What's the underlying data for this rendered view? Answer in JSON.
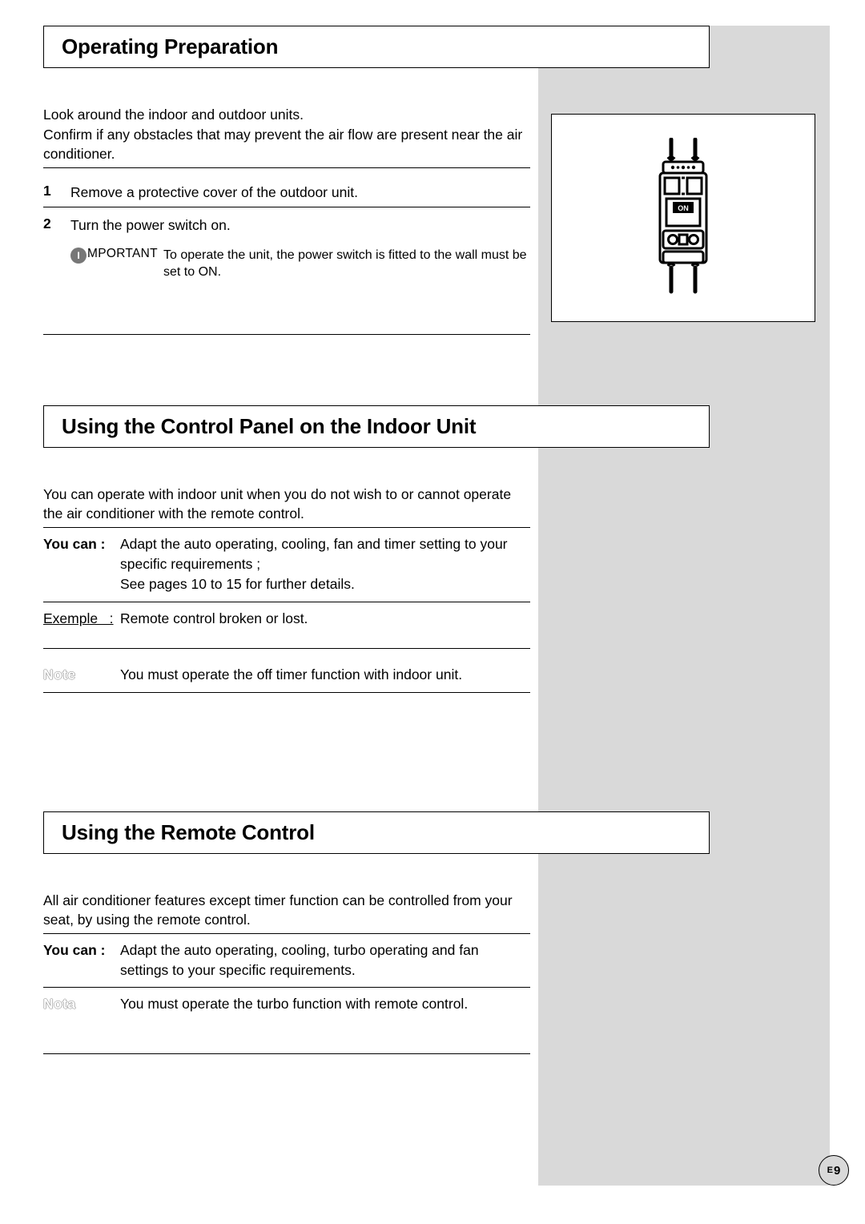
{
  "page_number_prefix": "E",
  "page_number": "9",
  "switch_label": "ON",
  "sections": [
    {
      "heading": "Operating Preparation",
      "intro": "Look around the indoor and outdoor units.\nConfirm if any obstacles that may prevent the air flow are present near the air conditioner.",
      "steps": [
        {
          "num": "1",
          "text": "Remove a protective cover of the outdoor unit."
        },
        {
          "num": "2",
          "text": "Turn the power switch on.",
          "important": {
            "icon_letter": "I",
            "label": "MPORTANT",
            "text": "To operate the unit, the power switch is fitted to the wall must be set to ON."
          }
        }
      ]
    },
    {
      "heading": "Using the Control Panel on the Indoor Unit",
      "intro": "You can operate with indoor unit when you do not wish to or cannot operate the air conditioner with the remote control.",
      "rows": [
        {
          "label": "You can :",
          "label_style": "bold",
          "value": "Adapt the auto operating, cooling, fan and timer setting to your specific requirements ;\nSee pages 10 to 15 for further details.",
          "border_top": true,
          "border_bottom": true
        },
        {
          "label": "Exemple   :",
          "label_style": "underline",
          "value": "Remote control broken or lost.",
          "border_bottom": true,
          "pad_below": true
        },
        {
          "label": "Note",
          "label_style": "outline",
          "value": "You must operate the off timer function with indoor unit.",
          "border_bottom": true
        }
      ]
    },
    {
      "heading": "Using the Remote Control",
      "intro": "All air conditioner features except timer function can be controlled from your seat, by using the remote control.",
      "rows": [
        {
          "label": "You can :",
          "label_style": "bold",
          "value": "Adapt the auto operating, cooling, turbo operating and fan settings to your specific requirements.",
          "border_top": true,
          "border_bottom": true
        },
        {
          "label": "Nota",
          "label_style": "outline",
          "value": "You must operate the turbo  function with remote control.",
          "pad_below": true
        }
      ]
    }
  ]
}
